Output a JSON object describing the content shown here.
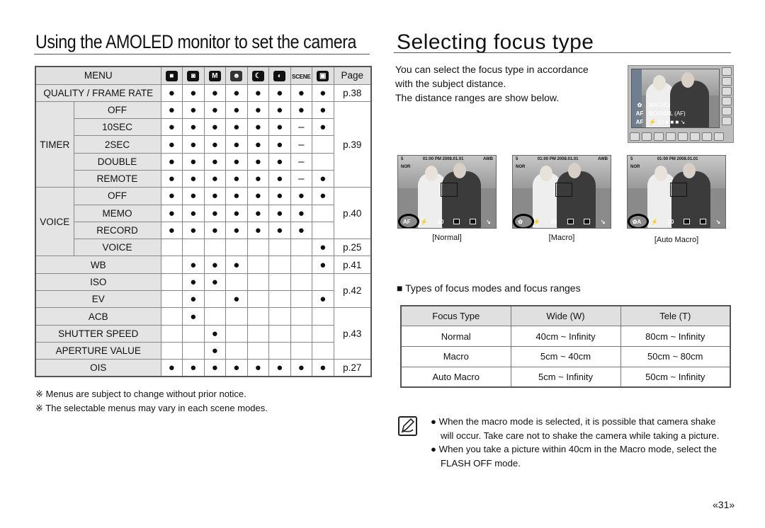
{
  "left": {
    "title": "Using the AMOLED monitor to set the camera",
    "table": {
      "header": {
        "menu": "MENU",
        "modes": [
          {
            "icon": "camera-auto-icon",
            "glyph": "◘"
          },
          {
            "icon": "camera-program-icon",
            "glyph": "◙"
          },
          {
            "icon": "manual-mode-icon",
            "glyph": "M"
          },
          {
            "icon": "dual-is-icon",
            "glyph": "☻"
          },
          {
            "icon": "night-mode-icon",
            "glyph": "☾"
          },
          {
            "icon": "beauty-shot-icon",
            "glyph": "◐"
          },
          {
            "icon": "scene-icon",
            "glyph": "SCENE"
          },
          {
            "icon": "movie-icon",
            "glyph": "▣"
          }
        ],
        "page": "Page"
      },
      "rows": [
        {
          "group": "",
          "item": "QUALITY / FRAME RATE",
          "marks": [
            "●",
            "●",
            "●",
            "●",
            "●",
            "●",
            "●",
            "●"
          ],
          "page": "p.38"
        },
        {
          "group": "TIMER",
          "item": "OFF",
          "marks": [
            "●",
            "●",
            "●",
            "●",
            "●",
            "●",
            "●",
            "●"
          ],
          "page": "p.39"
        },
        {
          "group": "TIMER",
          "item": "10SEC",
          "marks": [
            "●",
            "●",
            "●",
            "●",
            "●",
            "●",
            "–",
            "●"
          ],
          "page": "p.39"
        },
        {
          "group": "TIMER",
          "item": "2SEC",
          "marks": [
            "●",
            "●",
            "●",
            "●",
            "●",
            "●",
            "–",
            ""
          ],
          "page": "p.39"
        },
        {
          "group": "TIMER",
          "item": "DOUBLE",
          "marks": [
            "●",
            "●",
            "●",
            "●",
            "●",
            "●",
            "–",
            ""
          ],
          "page": "p.39"
        },
        {
          "group": "TIMER",
          "item": "REMOTE",
          "marks": [
            "●",
            "●",
            "●",
            "●",
            "●",
            "●",
            "–",
            "●"
          ],
          "page": "p.39"
        },
        {
          "group": "VOICE",
          "item": "OFF",
          "marks": [
            "●",
            "●",
            "●",
            "●",
            "●",
            "●",
            "●",
            "●"
          ],
          "page": "p.40"
        },
        {
          "group": "VOICE",
          "item": "MEMO",
          "marks": [
            "●",
            "●",
            "●",
            "●",
            "●",
            "●",
            "●",
            ""
          ],
          "page": "p.40"
        },
        {
          "group": "VOICE",
          "item": "RECORD",
          "marks": [
            "●",
            "●",
            "●",
            "●",
            "●",
            "●",
            "●",
            ""
          ],
          "page": "p.40"
        },
        {
          "group": "VOICE",
          "item": "VOICE",
          "marks": [
            "",
            "",
            "",
            "",
            "",
            "",
            "",
            "●"
          ],
          "page": "p.25"
        },
        {
          "group": "",
          "item": "WB",
          "marks": [
            "",
            "●",
            "●",
            "●",
            "",
            "",
            "",
            "●"
          ],
          "page": "p.41"
        },
        {
          "group": "",
          "item": "ISO",
          "marks": [
            "",
            "●",
            "●",
            "",
            "",
            "",
            "",
            ""
          ],
          "page": "p.42"
        },
        {
          "group": "",
          "item": "EV",
          "marks": [
            "",
            "●",
            "",
            "●",
            "",
            "",
            "",
            "●"
          ],
          "page": "p.42"
        },
        {
          "group": "",
          "item": "ACB",
          "marks": [
            "",
            "●",
            "",
            "",
            "",
            "",
            "",
            ""
          ],
          "page": "p.43"
        },
        {
          "group": "",
          "item": "SHUTTER SPEED",
          "marks": [
            "",
            "",
            "●",
            "",
            "",
            "",
            "",
            ""
          ],
          "page": "p.43"
        },
        {
          "group": "",
          "item": "APERTURE VALUE",
          "marks": [
            "",
            "",
            "●",
            "",
            "",
            "",
            "",
            ""
          ],
          "page": "p.43"
        },
        {
          "group": "",
          "item": "OIS",
          "marks": [
            "●",
            "●",
            "●",
            "●",
            "●",
            "●",
            "●",
            "●"
          ],
          "page": "p.27"
        }
      ]
    },
    "notes": [
      "※ Menus are subject to change without prior notice.",
      "※ The selectable menus may vary in each scene modes."
    ]
  },
  "right": {
    "title": "Selecting focus type",
    "intro": [
      "You can select the focus type in accordance",
      "with the subject distance.",
      "The distance ranges are show below."
    ],
    "camera_menu": {
      "options": [
        {
          "icon": "macro-icon",
          "side": "✿",
          "label": "MACRO"
        },
        {
          "icon": "af-icon",
          "side": "AF",
          "label": "NORMAL (AF)"
        }
      ],
      "bottom_left": "AF"
    },
    "screens": [
      {
        "caption": "[Normal]",
        "time": "01:00 PM 2008.01.01",
        "wb": "AWB",
        "quality": "NOR",
        "focus_indicator": "AF",
        "shots": "5"
      },
      {
        "caption": "[Macro]",
        "time": "01:00 PM 2008.01.01",
        "wb": "AWB",
        "quality": "NOR",
        "focus_indicator": "✿",
        "shots": "5"
      },
      {
        "caption": "[Auto Macro]",
        "time": "01:00 PM 2008.01.01",
        "wb": "",
        "quality": "NOR",
        "focus_indicator": "✿A",
        "shots": "5"
      }
    ],
    "section_heading": "■ Types of focus modes and focus ranges",
    "focus_table": {
      "headers": [
        "Focus Type",
        "Wide (W)",
        "Tele (T)"
      ],
      "rows": [
        [
          "Normal",
          "40cm ~ Infinity",
          "80cm ~ Infinity"
        ],
        [
          "Macro",
          "5cm ~ 40cm",
          "50cm ~ 80cm"
        ],
        [
          "Auto Macro",
          "5cm ~ Infinity",
          "50cm ~ Infinity"
        ]
      ]
    },
    "tips": [
      "● When the macro mode is selected, it is possible that camera shake will occur. Take care not to shake the camera while taking a picture.",
      "● When you take a picture within 40cm in the Macro mode, select the FLASH OFF mode."
    ]
  },
  "page_number": "«31»"
}
